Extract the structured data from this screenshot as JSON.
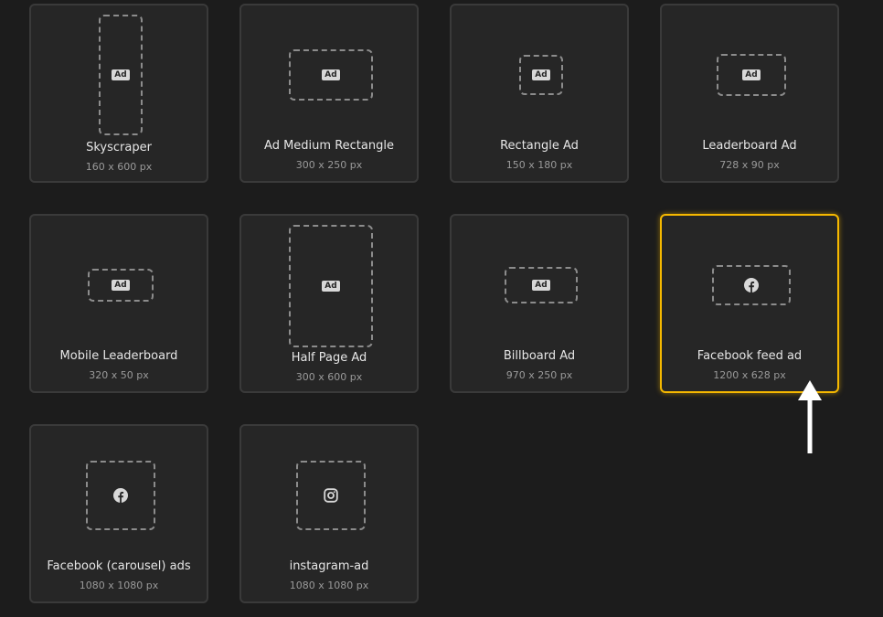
{
  "templates": [
    {
      "name": "Skyscraper",
      "size": "160 x 600 px",
      "icon": "ad-badge",
      "badge": "Ad"
    },
    {
      "name": "Ad Medium Rectangle",
      "size": "300 x 250 px",
      "icon": "ad-badge",
      "badge": "Ad"
    },
    {
      "name": "Rectangle Ad",
      "size": "150 x 180 px",
      "icon": "ad-badge",
      "badge": "Ad"
    },
    {
      "name": "Leaderboard Ad",
      "size": "728 x 90 px",
      "icon": "ad-badge",
      "badge": "Ad"
    },
    {
      "name": "Mobile Leaderboard",
      "size": "320 x 50 px",
      "icon": "ad-badge",
      "badge": "Ad"
    },
    {
      "name": "Half Page Ad",
      "size": "300 x 600 px",
      "icon": "ad-badge",
      "badge": "Ad"
    },
    {
      "name": "Billboard Ad",
      "size": "970 x 250 px",
      "icon": "ad-badge",
      "badge": "Ad"
    },
    {
      "name": "Facebook feed ad",
      "size": "1200 x 628 px",
      "icon": "facebook-icon",
      "selected": true
    },
    {
      "name": "Facebook (carousel) ads",
      "size": "1080 x 1080 px",
      "icon": "facebook-icon"
    },
    {
      "name": "instagram-ad",
      "size": "1080 x 1080 px",
      "icon": "instagram-icon"
    }
  ],
  "colors": {
    "background": "#1c1c1c",
    "card": "#262626",
    "card_border": "#3a3a3a",
    "selected_border": "#f5b800",
    "arrow": "#ffffff"
  }
}
